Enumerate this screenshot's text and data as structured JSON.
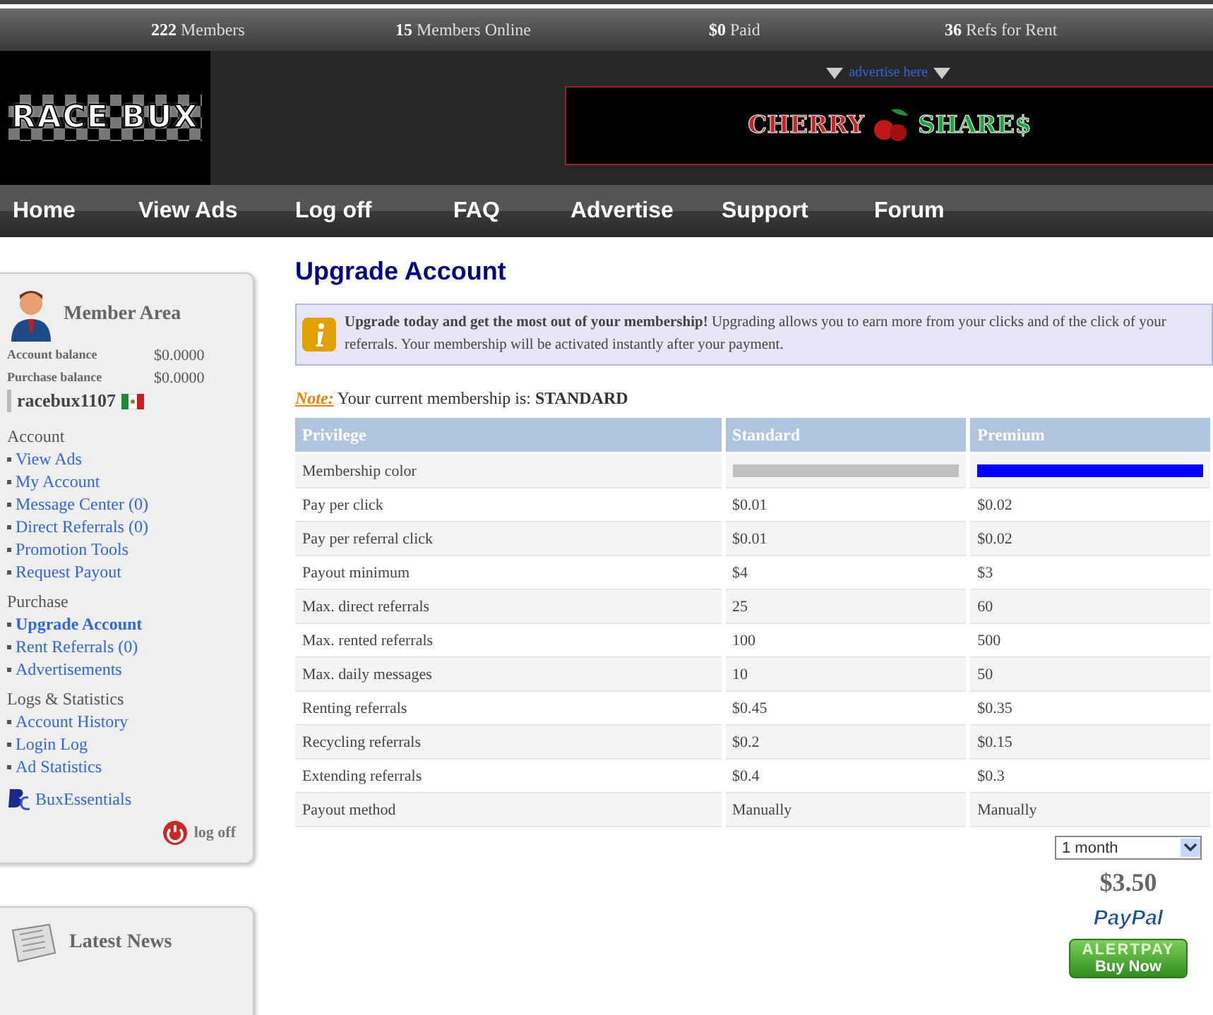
{
  "stats": [
    {
      "value": "222",
      "label": "Members"
    },
    {
      "value": "15",
      "label": "Members Online"
    },
    {
      "value": "$0",
      "label": "Paid"
    },
    {
      "value": "36",
      "label": "Refs for Rent"
    }
  ],
  "logo": {
    "text": "RACE BUX"
  },
  "banner": {
    "link": "advertise here",
    "words": [
      "CHERRY",
      "SHARE$"
    ]
  },
  "nav": [
    {
      "label": "Home"
    },
    {
      "label": "View Ads"
    },
    {
      "label": "Log off"
    },
    {
      "label": "FAQ"
    },
    {
      "label": "Advertise"
    },
    {
      "label": "Support"
    },
    {
      "label": "Forum"
    }
  ],
  "member_area": {
    "title": "Member Area",
    "balances": [
      {
        "label": "Account balance",
        "value": "$0.0000"
      },
      {
        "label": "Purchase balance",
        "value": "$0.0000"
      }
    ],
    "username": "racebux1107",
    "sections": [
      {
        "title": "Account",
        "items": [
          {
            "label": "View Ads",
            "selected": false
          },
          {
            "label": "My Account",
            "selected": false
          },
          {
            "label": "Message Center (0)",
            "selected": false
          },
          {
            "label": "Direct Referrals (0)",
            "selected": false
          },
          {
            "label": "Promotion Tools",
            "selected": false
          },
          {
            "label": "Request Payout",
            "selected": false
          }
        ]
      },
      {
        "title": "Purchase",
        "items": [
          {
            "label": "Upgrade Account",
            "selected": true
          },
          {
            "label": "Rent Referrals (0)",
            "selected": false
          },
          {
            "label": "Advertisements",
            "selected": false
          }
        ]
      },
      {
        "title": "Logs & Statistics",
        "items": [
          {
            "label": "Account History",
            "selected": false
          },
          {
            "label": "Login Log",
            "selected": false
          },
          {
            "label": "Ad Statistics",
            "selected": false
          }
        ]
      }
    ],
    "partner_link": "BuxEssentials",
    "logoff": "log off"
  },
  "news": {
    "title": "Latest News"
  },
  "page_title": "Upgrade Account",
  "info": "**Upgrade today and get the most out of your membership!** Upgrading allows you to earn more from your clicks and of the click of your referrals. Your membership will be activated instantly after your payment.",
  "note": {
    "label": "Note:",
    "text": "Your current membership is:",
    "membership": "STANDARD"
  },
  "table": {
    "columns": [
      {
        "label": "Privilege"
      },
      {
        "label": "Standard",
        "color": "#c0c0c0"
      },
      {
        "label": "Premium",
        "color": "#0000ff"
      }
    ],
    "rows": [
      {
        "kind": "color",
        "label": "Membership color"
      },
      {
        "kind": "text",
        "label": "Pay per click",
        "values": [
          "$0.01",
          "$0.02"
        ]
      },
      {
        "kind": "text",
        "label": "Pay per referral click",
        "values": [
          "$0.01",
          "$0.02"
        ]
      },
      {
        "kind": "text",
        "label": "Payout minimum",
        "values": [
          "$4",
          "$3"
        ]
      },
      {
        "kind": "text",
        "label": "Max. direct referrals",
        "values": [
          "25",
          "60"
        ]
      },
      {
        "kind": "text",
        "label": "Max. rented referrals",
        "values": [
          "100",
          "500"
        ]
      },
      {
        "kind": "text",
        "label": "Max. daily messages",
        "values": [
          "10",
          "50"
        ]
      },
      {
        "kind": "text",
        "label": "Renting referrals",
        "values": [
          "$0.45",
          "$0.35"
        ]
      },
      {
        "kind": "text",
        "label": "Recycling referrals",
        "values": [
          "$0.2",
          "$0.15"
        ]
      },
      {
        "kind": "text",
        "label": "Extending referrals",
        "values": [
          "$0.4",
          "$0.3"
        ]
      },
      {
        "kind": "text",
        "label": "Payout method",
        "values": [
          "Manually",
          "Manually"
        ]
      }
    ]
  },
  "purchase": {
    "period": "1 month",
    "price": "$3.50",
    "paypal": "PayPal",
    "alertpay": {
      "brand": "ALERTPAY",
      "action": "Buy Now"
    }
  }
}
